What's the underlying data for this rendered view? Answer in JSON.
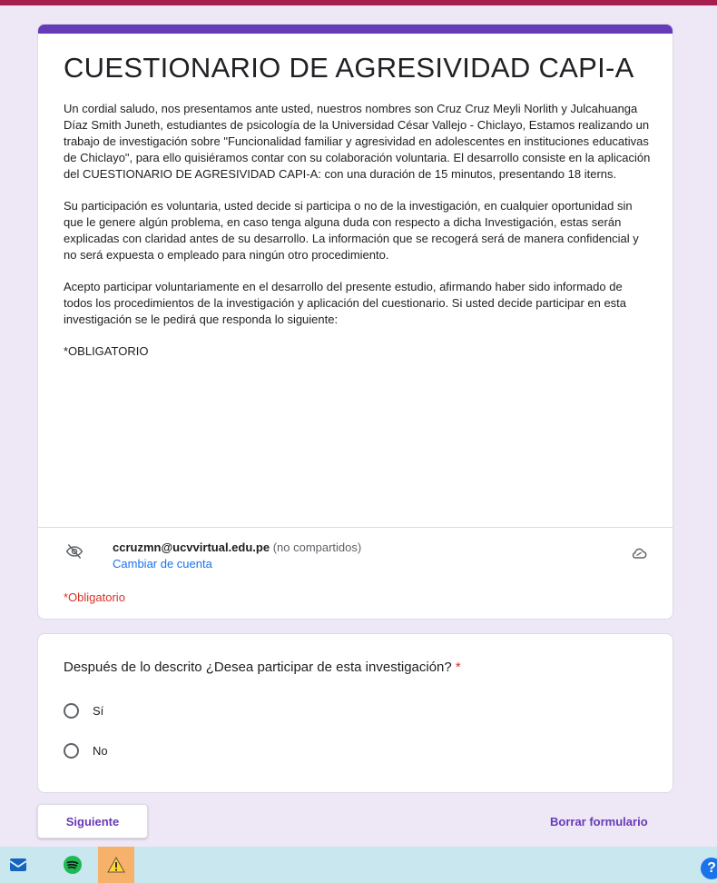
{
  "form": {
    "title": "CUESTIONARIO  DE AGRESIVIDAD CAPI-A",
    "description": [
      "Un cordial saludo, nos presentamos ante usted, nuestros nombres son Cruz Cruz Meyli Norlith y Julcahuanga Díaz Smith Juneth, estudiantes de psicología de la Universidad César Vallejo - Chiclayo, Estamos realizando un trabajo de investigación sobre \"Funcionalidad familiar y agresividad en adolescentes en instituciones educativas  de Chiclayo\", para ello quisiéramos contar con su colaboración voluntaria. El desarrollo consiste en la aplicación del CUESTIONARIO DE AGRESIVIDAD CAPI-A: con una duración de 15 minutos, presentando 18 iterns.",
      "Su participación es voluntaria, usted decide si participa o no de la investigación, en cualquier oportunidad sin que le genere algún problema, en caso tenga alguna duda con respecto a dicha Investigación, estas serán explicadas con claridad antes de su desarrollo. La información que se recogerá será de manera confidencial y no será expuesta o empleado para ningún otro procedimiento.",
      "Acepto participar voluntariamente en el desarrollo del presente estudio, afirmando haber sido informado de todos los procedimientos de la investigación y aplicación del cuestionario. Si usted decide participar en esta investigación se le pedirá que responda lo siguiente:",
      "*OBLIGATORIO"
    ],
    "account": {
      "email": "ccruzmn@ucvvirtual.edu.pe",
      "not_shared": "(no compartidos)",
      "switch_label": "Cambiar de cuenta"
    },
    "required_note": "*Obligatorio"
  },
  "question": {
    "text": "Después de lo descrito ¿Desea participar de esta investigación?",
    "required_mark": "*",
    "options": [
      "Sí",
      "No"
    ]
  },
  "actions": {
    "next_label": "Siguiente",
    "clear_label": "Borrar formulario"
  },
  "taskbar": {
    "items": [
      "mail-icon",
      "spotify-icon",
      "warning-icon"
    ],
    "help_glyph": "?"
  },
  "colors": {
    "accent": "#673ab7",
    "required": "#d93025",
    "link": "#1a73e8",
    "background": "#ede7f6"
  }
}
